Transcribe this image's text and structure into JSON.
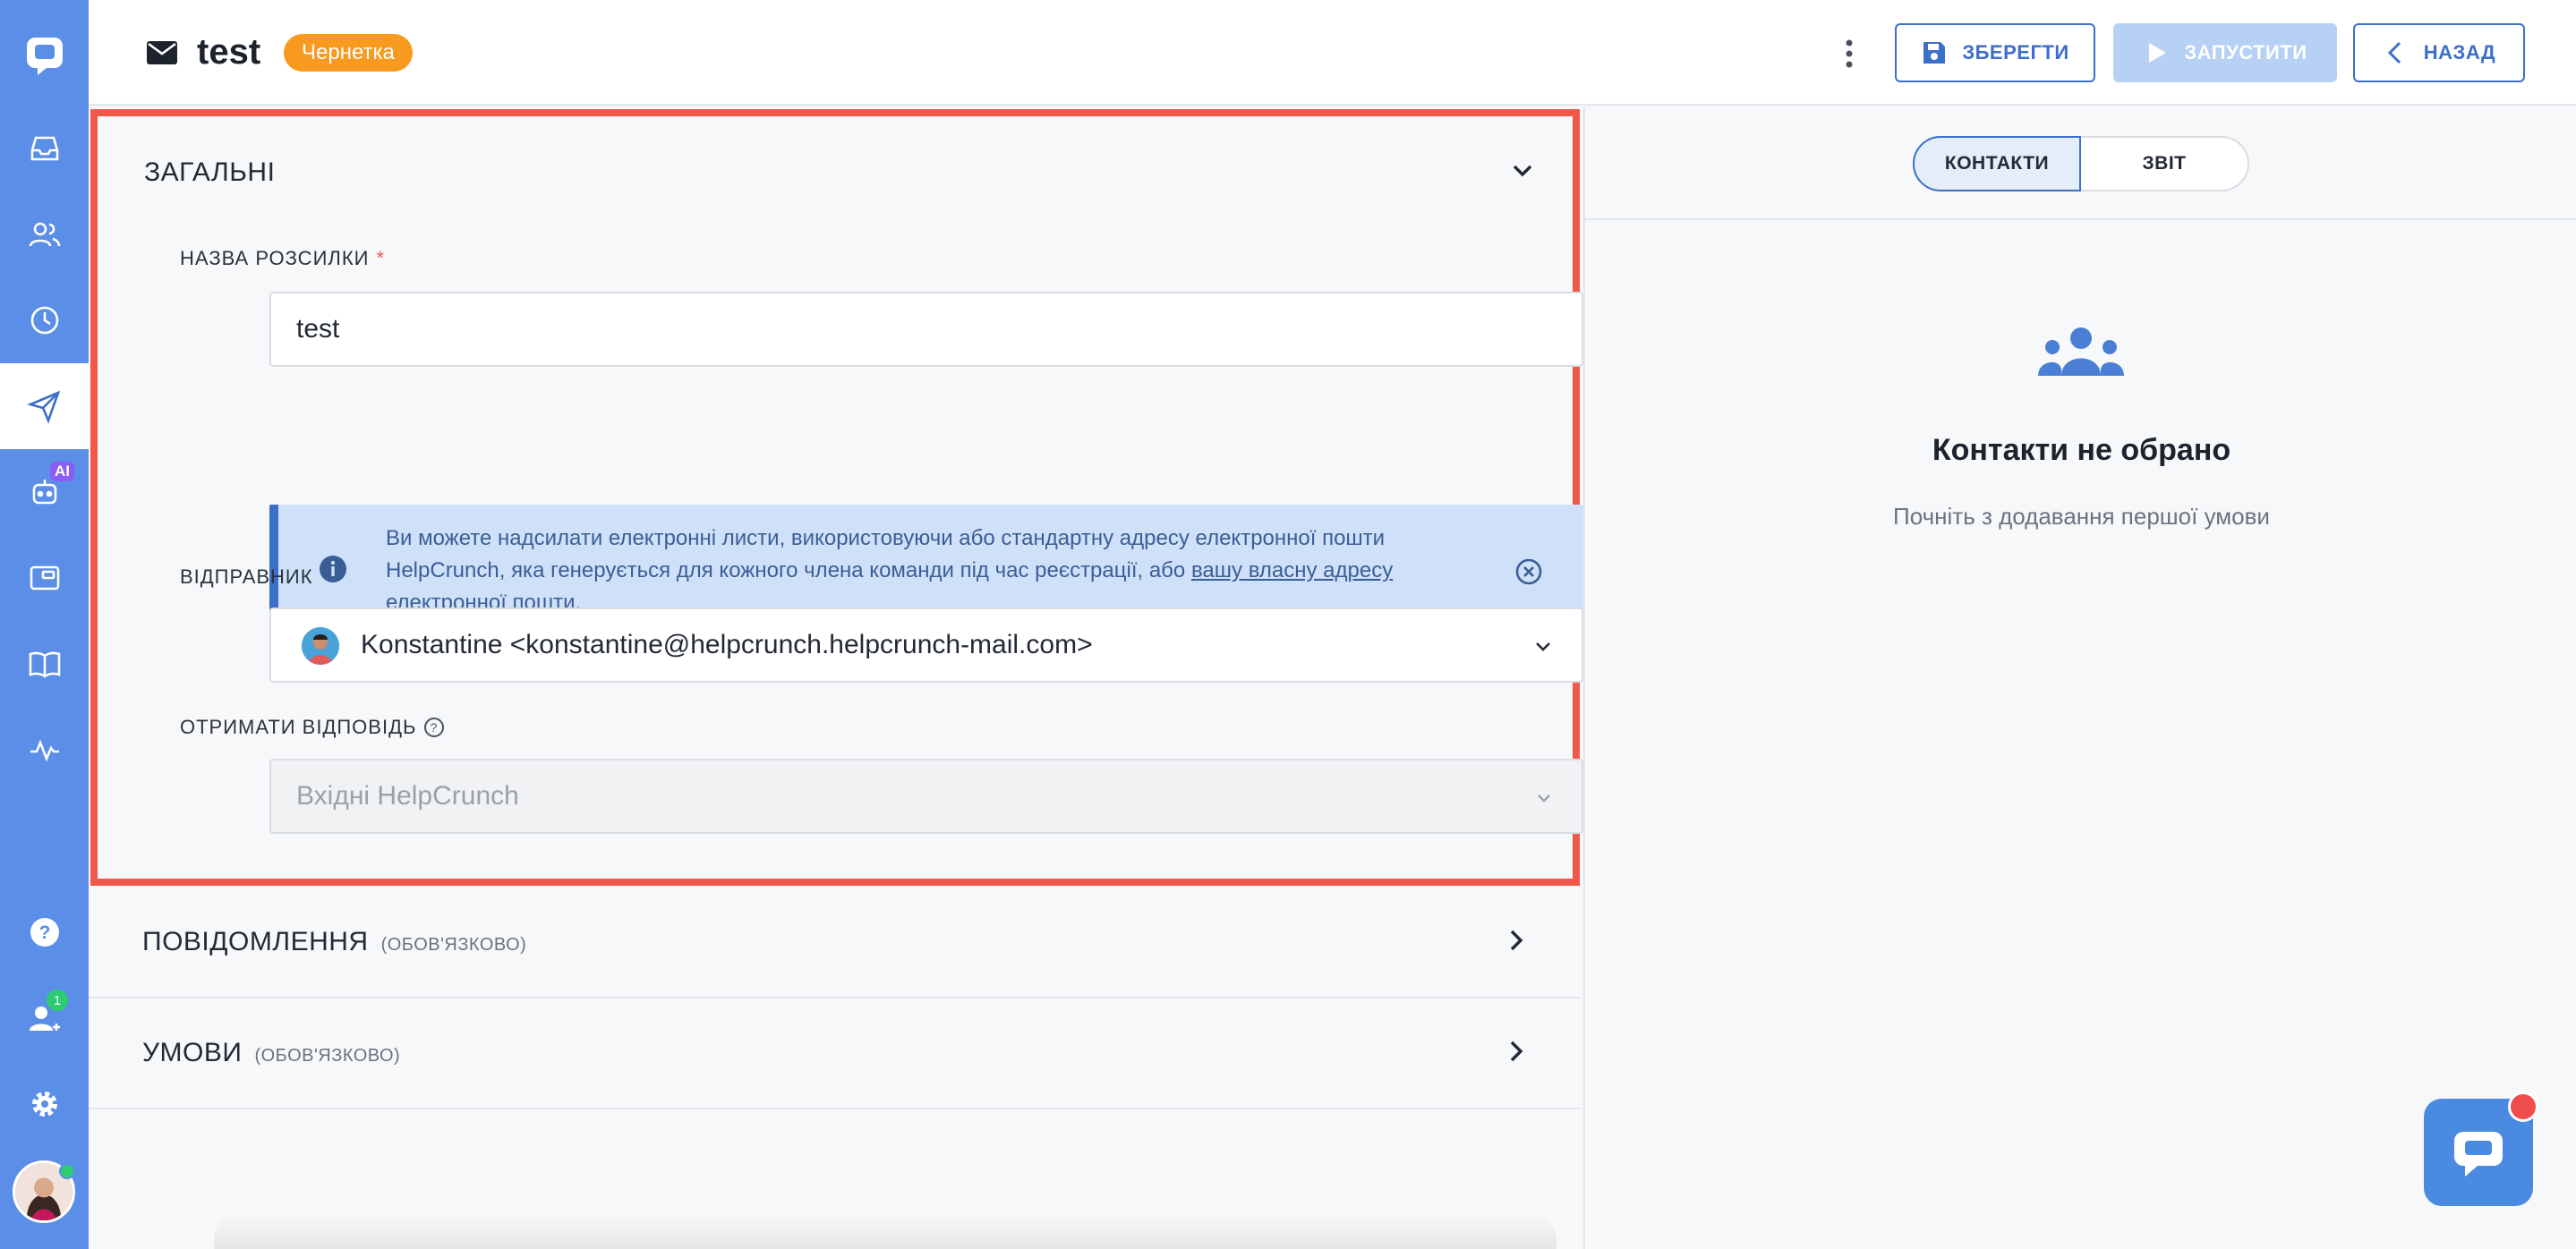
{
  "header": {
    "title": "test",
    "status_badge": "Чернетка",
    "save_label": "ЗБЕРЕГТИ",
    "launch_label": "ЗАПУСТИТИ",
    "back_label": "НАЗАД"
  },
  "sidebar": {
    "items": [
      {
        "icon": "inbox-icon"
      },
      {
        "icon": "contacts-icon"
      },
      {
        "icon": "history-icon"
      },
      {
        "icon": "campaigns-icon",
        "active": true
      },
      {
        "icon": "ai-bot-icon",
        "badge": "AI"
      },
      {
        "icon": "popups-icon"
      },
      {
        "icon": "knowledge-base-icon"
      },
      {
        "icon": "statistics-icon"
      },
      {
        "icon": "help-icon"
      },
      {
        "icon": "team-icon",
        "badge": "1"
      },
      {
        "icon": "settings-icon"
      }
    ]
  },
  "general": {
    "title": "ЗАГАЛЬНІ",
    "name_label": "НАЗВА РОЗСИЛКИ",
    "required_mark": "*",
    "name_value": "test",
    "info_text": "Ви можете надсилати електронні листи, використовуючи або стандартну адресу електронної пошти HelpCrunch, яка генерується для кожного члена команди під час реєстрації, або ",
    "info_link": "вашу власну адресу електронної пошти",
    "info_end": ".",
    "sender_label": "ВІДПРАВНИК",
    "sender_value": "Konstantine <konstantine@helpcrunch.helpcrunch-mail.com>",
    "reply_label": "ОТРИМАТИ ВІДПОВІДЬ",
    "reply_value": "Вхідні HelpCrunch"
  },
  "sections": {
    "messages_title": "ПОВІДОМЛЕННЯ",
    "messages_note": "(ОБОВ'ЯЗКОВО)",
    "conditions_title": "УМОВИ",
    "conditions_note": "(ОБОВ'ЯЗКОВО)"
  },
  "right": {
    "tab_contacts": "КОНТАКТИ",
    "tab_report": "ЗВІТ",
    "empty_title": "Контакти не обрано",
    "empty_subtitle": "Почніть з додавання першої умови"
  },
  "colors": {
    "sidebar": "#5b8ee6",
    "accent": "#3b6fc9",
    "draft_badge": "#f79a1f",
    "highlight": "#f2584a"
  }
}
